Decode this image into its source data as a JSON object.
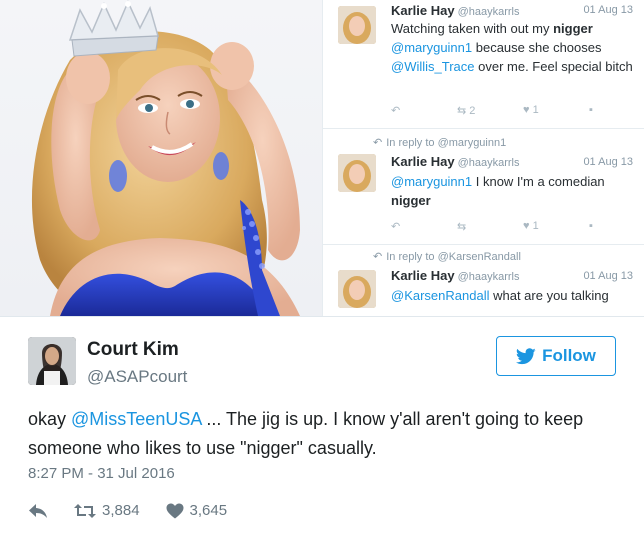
{
  "thread": [
    {
      "reply_to": "",
      "name": "Karlie Hay",
      "handle": "@haaykarrls",
      "date": "01 Aug 13",
      "text_parts": [
        {
          "t": "Watching taken with out my ",
          "k": "plain"
        },
        {
          "t": "nigger",
          "k": "bold"
        },
        {
          "t": " ",
          "k": "plain"
        },
        {
          "t": "@maryguinn1",
          "k": "mention"
        },
        {
          "t": " because she chooses ",
          "k": "plain"
        },
        {
          "t": "@Willis_Trace",
          "k": "mention"
        },
        {
          "t": " over me. Feel special bitch",
          "k": "plain"
        }
      ],
      "retweets": "2",
      "likes": "1"
    },
    {
      "reply_to": "In reply to @maryguinn1",
      "name": "Karlie Hay",
      "handle": "@haaykarrls",
      "date": "01 Aug 13",
      "text_parts": [
        {
          "t": "@maryguinn1",
          "k": "mention"
        },
        {
          "t": " I know I'm a comedian ",
          "k": "plain"
        },
        {
          "t": "nigger",
          "k": "bold"
        }
      ],
      "retweets": "",
      "likes": "1"
    },
    {
      "reply_to": "In reply to @KarsenRandall",
      "name": "Karlie Hay",
      "handle": "@haaykarrls",
      "date": "01 Aug 13",
      "text_parts": [
        {
          "t": "@KarsenRandall",
          "k": "mention"
        },
        {
          "t": " what are you talking",
          "k": "plain"
        }
      ],
      "retweets": "",
      "likes": ""
    }
  ],
  "tweet": {
    "author_name": "Court Kim",
    "author_handle": "@ASAPcourt",
    "follow_label": "Follow",
    "text_before": "okay ",
    "mention": "@MissTeenUSA",
    "text_after": " ... The jig is up. I know y'all aren't going to keep someone who likes to use \"nigger\" casually.",
    "timestamp": "8:27 PM - 31 Jul 2016",
    "retweet_count": "3,884",
    "like_count": "3,645"
  },
  "colors": {
    "brand_blue": "#1b95e0",
    "text_dark": "#1c2022",
    "text_muted": "#697882",
    "dress_blue": "#2a3fc8"
  },
  "icons": [
    "reply-icon",
    "retweet-icon",
    "heart-icon",
    "bird-icon",
    "crown-icon"
  ]
}
